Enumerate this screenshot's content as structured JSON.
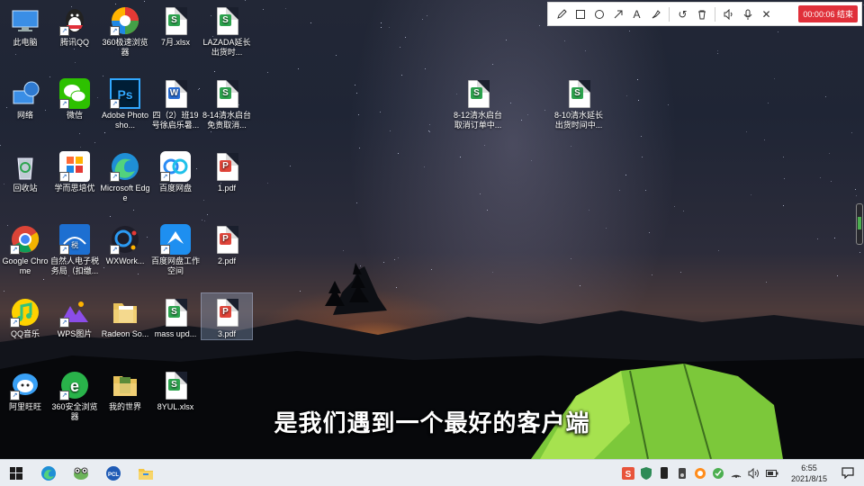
{
  "desktop_icons": [
    {
      "label": "此电脑",
      "icon": "this-pc-icon"
    },
    {
      "label": "腾讯QQ",
      "icon": "qq-icon"
    },
    {
      "label": "360极速浏览器",
      "icon": "360-browser-icon"
    },
    {
      "label": "7月.xlsx",
      "icon": "spreadsheet-file-icon"
    },
    {
      "label": "LAZADA延长出货时...",
      "icon": "spreadsheet-file-icon"
    },
    {
      "label": "网络",
      "icon": "network-icon"
    },
    {
      "label": "微信",
      "icon": "wechat-icon"
    },
    {
      "label": "Adobe Photosho...",
      "icon": "photoshop-icon"
    },
    {
      "label": "四（2）班19号徐启乐暑...",
      "icon": "word-file-icon"
    },
    {
      "label": "8-14清水启台免责取消...",
      "icon": "spreadsheet-file-icon"
    },
    {
      "label": "8-12清水启台取消订单中...",
      "icon": "spreadsheet-file-icon"
    },
    {
      "label": "8-10清水延长出货时间中...",
      "icon": "spreadsheet-file-icon"
    },
    {
      "label": "回收站",
      "icon": "recycle-bin-icon"
    },
    {
      "label": "学而思培优",
      "icon": "xueersi-icon"
    },
    {
      "label": "Microsoft Edge",
      "icon": "edge-icon"
    },
    {
      "label": "百度网盘",
      "icon": "baidu-netdisk-icon"
    },
    {
      "label": "1.pdf",
      "icon": "pdf-file-icon"
    },
    {
      "label": "Google Chrome",
      "icon": "chrome-icon"
    },
    {
      "label": "自然人电子税务局（扣缴...",
      "icon": "tax-bureau-icon"
    },
    {
      "label": "WXWork...",
      "icon": "wxwork-icon"
    },
    {
      "label": "百度网盘工作空间",
      "icon": "baidu-workspace-icon"
    },
    {
      "label": "2.pdf",
      "icon": "pdf-file-icon"
    },
    {
      "label": "QQ音乐",
      "icon": "qq-music-icon"
    },
    {
      "label": "WPS图片",
      "icon": "wps-picture-icon"
    },
    {
      "label": "Radeon So...",
      "icon": "radeon-folder-icon"
    },
    {
      "label": "mass upd...",
      "icon": "spreadsheet-file-icon"
    },
    {
      "label": "3.pdf",
      "icon": "pdf-file-icon"
    },
    {
      "label": "阿里旺旺",
      "icon": "aliwangwang-icon"
    },
    {
      "label": "360安全浏览器",
      "icon": "360-safe-browser-icon"
    },
    {
      "label": "我的世界",
      "icon": "minecraft-folder-icon"
    },
    {
      "label": "8YUL.xlsx",
      "icon": "spreadsheet-file-icon"
    }
  ],
  "recording_toolbar": {
    "tools": [
      "pencil-icon",
      "rectangle-icon",
      "ellipse-icon",
      "arrow-icon",
      "text-icon",
      "highlighter-icon",
      "undo-icon",
      "trash-icon",
      "speaker-icon",
      "microphone-icon",
      "close-icon"
    ],
    "timer": "00:00:06",
    "stop_label": "结束",
    "record_color": "#e0303a"
  },
  "subtitle": "是我们遇到一个最好的客户端",
  "taskbar": {
    "pinned": [
      "windows-start-icon",
      "edge-icon",
      "frog-app-icon",
      "pcl-icon",
      "file-explorer-icon"
    ],
    "tray": [
      "wps-tray-icon",
      "shield-icon",
      "phone-icon",
      "speaker-tray-icon",
      "360-tray-icon",
      "security-tray-icon",
      "network-tray-icon",
      "volume-icon",
      "battery-icon"
    ],
    "time": "6:55",
    "date": "2021/8/15"
  }
}
